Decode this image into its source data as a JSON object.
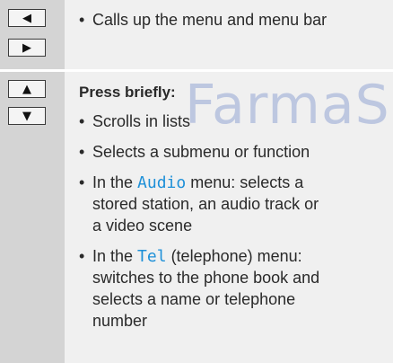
{
  "keys": {
    "left": "◀",
    "right": "▶",
    "up": "▲",
    "down": "▼"
  },
  "row1": {
    "bullet": "Calls up the menu and menu bar"
  },
  "row2": {
    "heading": "Press briefly:",
    "items": [
      "Scrolls in lists",
      "Selects a submenu or function"
    ],
    "audio_prefix": "In the ",
    "audio_term": "Audio",
    "audio_suffix_1": " menu: selects a",
    "audio_line2": "stored station, an audio track or",
    "audio_line3": "a video scene",
    "tel_prefix": "In the ",
    "tel_term": "Tel",
    "tel_suffix_1": " (telephone) menu:",
    "tel_line2": "switches to the phone book and",
    "tel_line3": "selects a name or telephone",
    "tel_line4": "number"
  },
  "watermark": "FarmaS",
  "colors": {
    "left_column": "#d4d4d4",
    "right_column": "#f0f0f0",
    "term_blue": "#1e90d8",
    "watermark": "#6d86c8"
  }
}
